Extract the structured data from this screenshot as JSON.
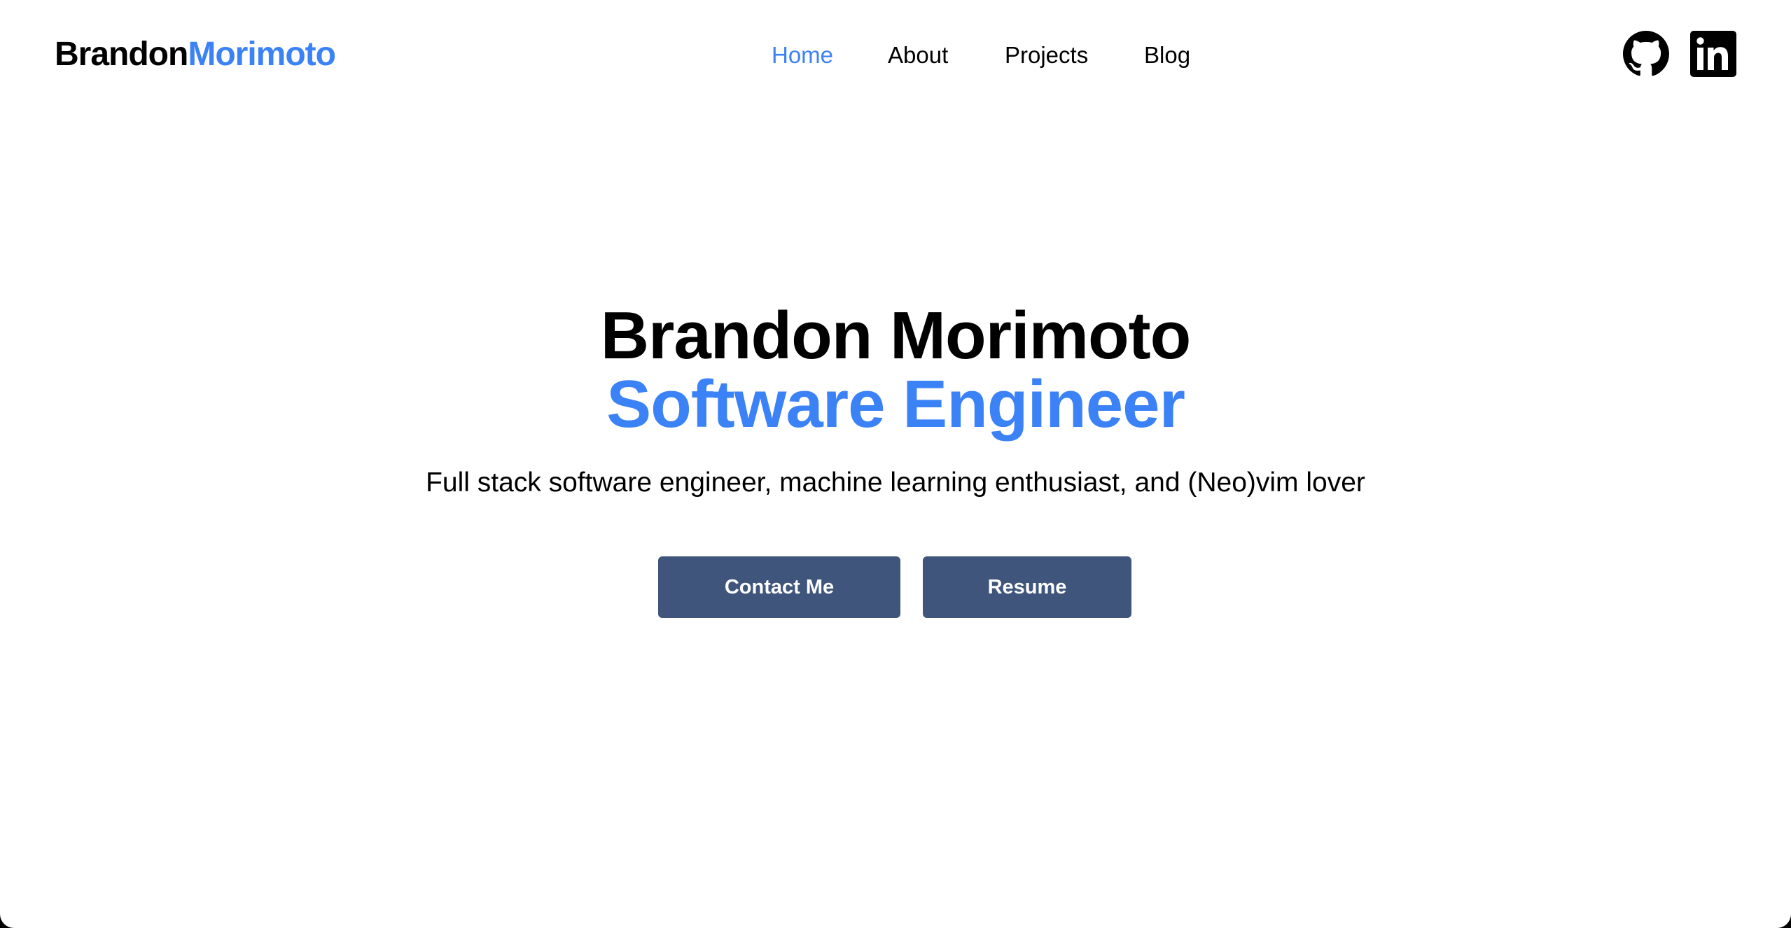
{
  "header": {
    "logo_first": "Brandon",
    "logo_last": "Morimoto",
    "nav": [
      {
        "label": "Home",
        "active": true
      },
      {
        "label": "About",
        "active": false
      },
      {
        "label": "Projects",
        "active": false
      },
      {
        "label": "Blog",
        "active": false
      }
    ],
    "social": [
      {
        "icon": "github-icon"
      },
      {
        "icon": "linkedin-icon"
      }
    ]
  },
  "hero": {
    "name": "Brandon Morimoto",
    "role": "Software Engineer",
    "tagline": "Full stack software engineer, machine learning enthusiast, and (Neo)vim lover",
    "buttons": {
      "contact": "Contact Me",
      "resume": "Resume"
    }
  },
  "colors": {
    "accent": "#3b82f6",
    "button": "#3f557c",
    "text": "#000000",
    "background": "#ffffff"
  }
}
